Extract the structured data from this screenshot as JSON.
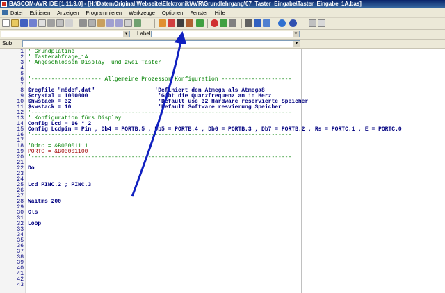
{
  "window": {
    "title": "BASCOM-AVR IDE [1.11.9.0] - [H:\\Daten\\Original Webseite\\Elektronik\\AVR\\Grundlehrgang\\07_Taster_Eingabe\\Taster_Eingabe_1A.bas]"
  },
  "menu": {
    "items": [
      {
        "label": "Datei"
      },
      {
        "label": "Editieren"
      },
      {
        "label": "Anzeigen"
      },
      {
        "label": "Programmieren"
      },
      {
        "label": "Werkzeuge"
      },
      {
        "label": "Optionen"
      },
      {
        "label": "Fenster"
      },
      {
        "label": "Hilfe"
      }
    ]
  },
  "toolbar": {
    "label_text": "Label",
    "sub_text": "Sub"
  },
  "editor": {
    "line_numbers": [
      "1",
      "2",
      "3",
      "4",
      "5",
      "6",
      "7",
      "8",
      "9",
      "10",
      "11",
      "12",
      "13",
      "14",
      "15",
      "16",
      "17",
      "18",
      "19",
      "20",
      "21",
      "22",
      "23",
      "24",
      "25",
      "26",
      "27",
      "28",
      "29",
      "30",
      "31",
      "32",
      "33",
      "34",
      "35",
      "36",
      "37",
      "38",
      "39",
      "40",
      "41",
      "42",
      "43"
    ],
    "lines": [
      "' Grundplatine",
      "' Tasterabfrage_1A",
      "' Angeschlossen Display  und zwei Taster",
      "",
      "",
      "'--------------------- Allgemeine Prozessor Konfiguration ---------------------",
      "'",
      "$regfile \"m8def.dat\"                  'Definiert den Atmega als Atmega8",
      "$crystal = 1000000                     'Gibt die Quarzfrequenz an in Herz",
      "$hwstack = 32                          'Default use 32 Hardware reservierte Speicher",
      "$swstack = 10                          'Default Software resvierung Speicher",
      "'------------------------------------------------------------------------------",
      "' Konfiguration fürs Display",
      "Config Lcd = 16 * 2",
      "Config Lcdpin = Pin , Db4 = PORTB.5 , Db5 = PORTB.4 , Db6 = PORTB.3 , Db7 = PORTB.2 , Rs = PORTC.1 , E = PORTC.0",
      "'------------------------------------------------------------------------------",
      "",
      "'Ddrc = &B00001111",
      "PORTC = &B00001100",
      "'------------------------------------------------------------------------------",
      "",
      "Do",
      "",
      "",
      "Lcd PINC.2 ; PINC.3",
      "",
      "",
      "Waitms 200",
      "",
      "Cls",
      "",
      "Loop"
    ]
  }
}
